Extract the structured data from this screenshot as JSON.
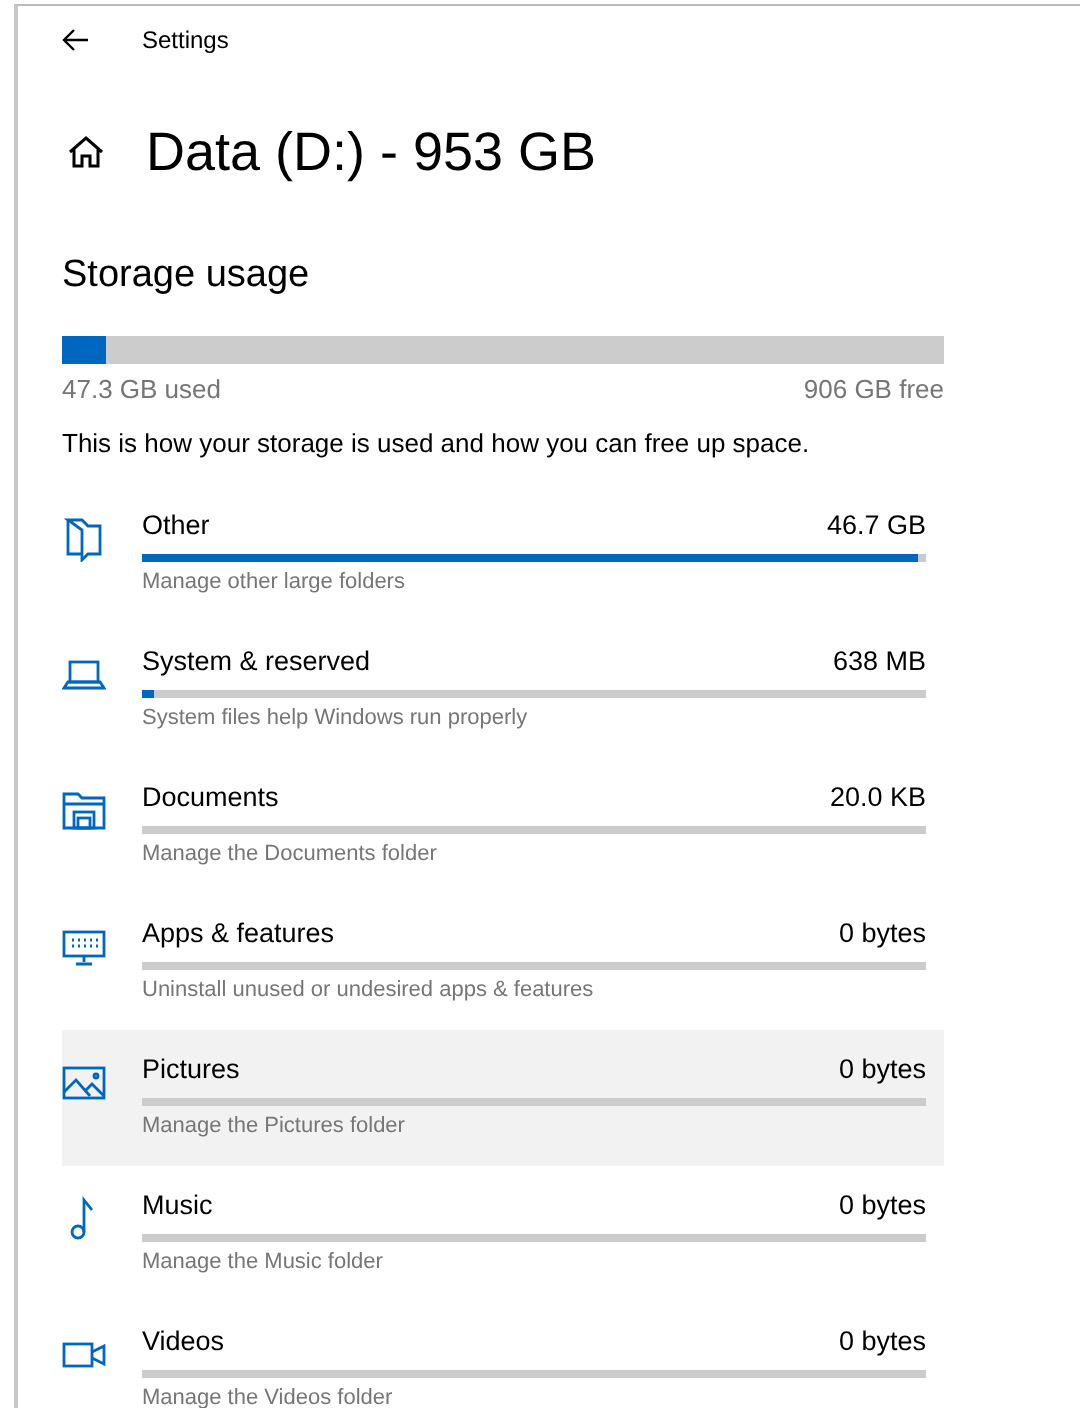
{
  "window": {
    "title": "Settings"
  },
  "header": {
    "title": "Data (D:) - 953 GB"
  },
  "storage": {
    "heading": "Storage usage",
    "level": 0.05,
    "used": "47.3 GB used",
    "free": "906 GB free",
    "description": "This is how your storage is used and how you can free up space."
  },
  "categories": [
    {
      "kind": "other",
      "name": "Other",
      "size": "46.7 GB",
      "level": 0.99,
      "hint": "Manage other large folders",
      "selected": false
    },
    {
      "kind": "system",
      "name": "System & reserved",
      "size": "638 MB",
      "level": 0.015,
      "hint": "System files help Windows run properly",
      "selected": false
    },
    {
      "kind": "documents",
      "name": "Documents",
      "size": "20.0 KB",
      "level": 0,
      "hint": "Manage the Documents folder",
      "selected": false
    },
    {
      "kind": "apps",
      "name": "Apps & features",
      "size": "0 bytes",
      "level": 0,
      "hint": "Uninstall unused or undesired apps & features",
      "selected": false
    },
    {
      "kind": "pictures",
      "name": "Pictures",
      "size": "0 bytes",
      "level": 0,
      "hint": "Manage the Pictures folder",
      "selected": true
    },
    {
      "kind": "music",
      "name": "Music",
      "size": "0 bytes",
      "level": 0,
      "hint": "Manage the Music folder",
      "selected": false
    },
    {
      "kind": "videos",
      "name": "Videos",
      "size": "0 bytes",
      "level": 0,
      "hint": "Manage the Videos folder",
      "selected": false
    }
  ]
}
